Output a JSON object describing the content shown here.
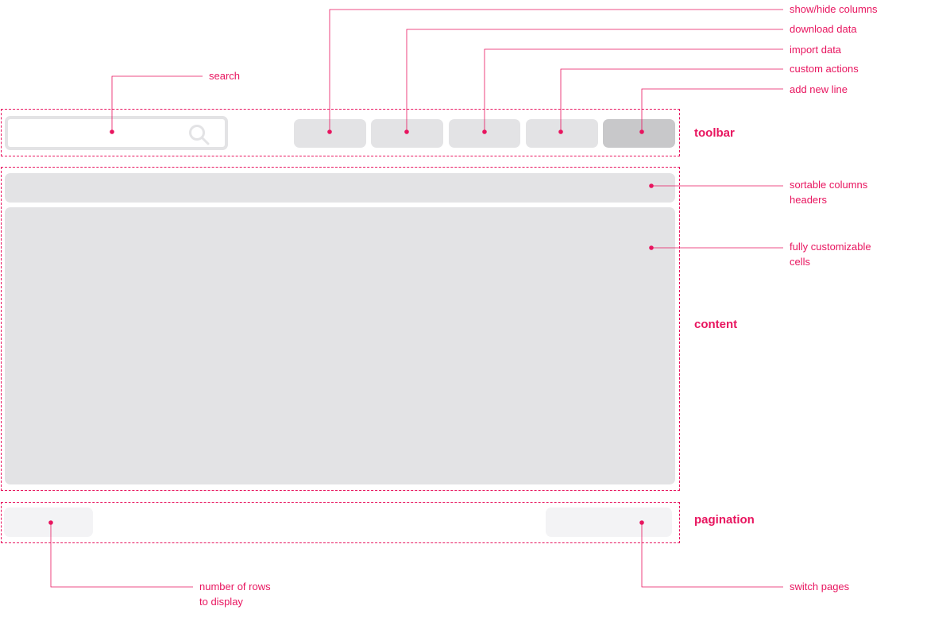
{
  "sections": {
    "toolbar": "toolbar",
    "content": "content",
    "pagination": "pagination"
  },
  "annotations": {
    "search": "search",
    "show_hide_columns": "show/hide columns",
    "download_data": "download data",
    "import_data": "import data",
    "custom_actions": "custom actions",
    "add_new_line": "add new line",
    "sortable_headers_line1": "sortable columns",
    "sortable_headers_line2": "headers",
    "custom_cells_line1": "fully customizable",
    "custom_cells_line2": "cells",
    "rows_to_display_line1": "number of rows",
    "rows_to_display_line2": "to display",
    "switch_pages": "switch pages"
  },
  "colors": {
    "accent": "#e8155f",
    "placeholder": "#e3e3e5",
    "placeholder_dark": "#c8c8ca",
    "placeholder_light": "#f3f3f5"
  },
  "icons": {
    "search": "search-icon"
  }
}
